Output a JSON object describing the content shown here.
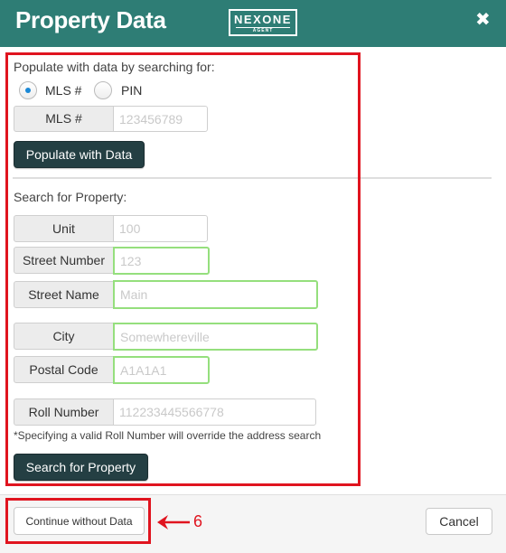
{
  "dialog": {
    "title": "Property Data",
    "logo": {
      "main": "NEXONE",
      "sub": "AGENT"
    },
    "close_glyph": "✖"
  },
  "populate": {
    "heading": "Populate with data by searching for:",
    "radios": [
      {
        "label": "MLS #",
        "checked": true
      },
      {
        "label": "PIN",
        "checked": false
      }
    ],
    "mls_label": "MLS #",
    "mls_placeholder": "123456789",
    "button": "Populate with Data"
  },
  "search": {
    "heading": "Search for Property:",
    "fields": {
      "unit": {
        "label": "Unit",
        "placeholder": "100"
      },
      "street_number": {
        "label": "Street Number",
        "placeholder": "123"
      },
      "street_name": {
        "label": "Street Name",
        "placeholder": "Main"
      },
      "city": {
        "label": "City",
        "placeholder": "Somewhereville"
      },
      "postal_code": {
        "label": "Postal Code",
        "placeholder": "A1A1A1"
      },
      "roll_number": {
        "label": "Roll Number",
        "placeholder": "112233445566778"
      }
    },
    "note": "*Specifying a valid Roll Number will override the address search",
    "button": "Search for Property"
  },
  "footer": {
    "continue_button": "Continue without Data",
    "cancel_button": "Cancel"
  },
  "annotation": {
    "number": "6"
  },
  "colors": {
    "header": "#2e7d75",
    "dark_button": "#243f43",
    "annotation_red": "#e0141f",
    "valid_border": "#95df7d"
  }
}
